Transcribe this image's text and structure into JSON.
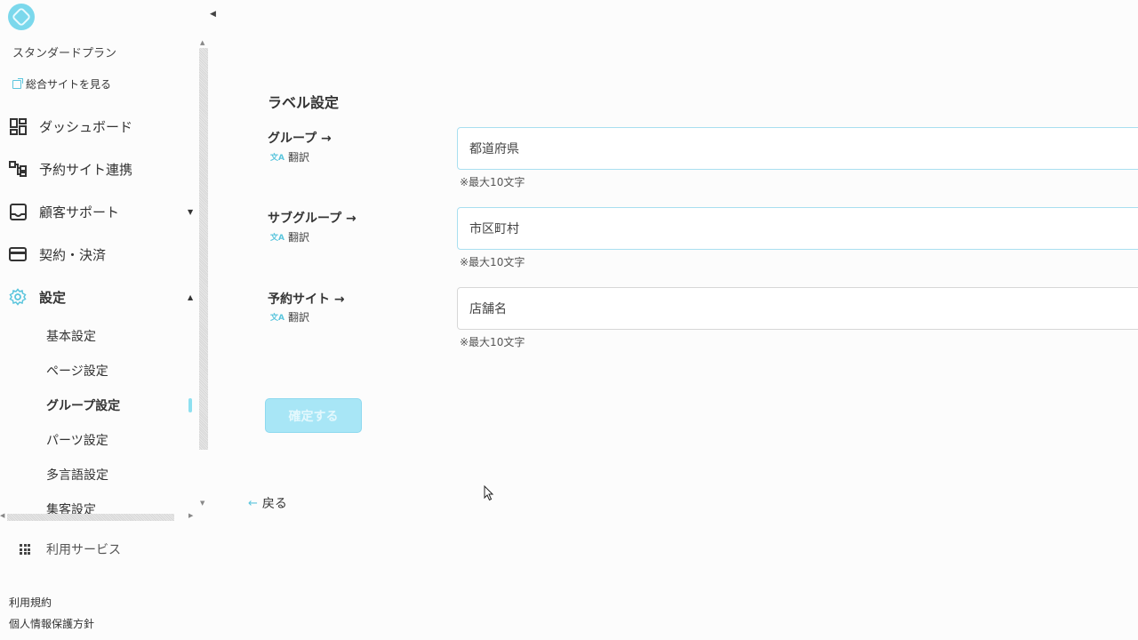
{
  "sidebar": {
    "plan": "スタンダードプラン",
    "portal_link": "総合サイトを見る",
    "nav": [
      {
        "label": "ダッシュボード"
      },
      {
        "label": "予約サイト連携"
      },
      {
        "label": "顧客サポート"
      },
      {
        "label": "契約・決済"
      },
      {
        "label": "設定"
      }
    ],
    "sub_nav": [
      {
        "label": "基本設定"
      },
      {
        "label": "ページ設定"
      },
      {
        "label": "グループ設定"
      },
      {
        "label": "パーツ設定"
      },
      {
        "label": "多言語設定"
      },
      {
        "label": "集客設定"
      }
    ],
    "services": "利用サービス",
    "footer": [
      "利用規約",
      "個人情報保護方針"
    ]
  },
  "main": {
    "section_title": "ラベル設定",
    "rows": [
      {
        "label": "グループ →",
        "translate": "翻訳",
        "value": "都道府県",
        "hint": "※最大10文字"
      },
      {
        "label": "サブグループ →",
        "translate": "翻訳",
        "value": "市区町村",
        "hint": "※最大10文字"
      },
      {
        "label": "予約サイト →",
        "translate": "翻訳",
        "value": "店舗名",
        "hint": "※最大10文字"
      }
    ],
    "confirm_label": "確定する",
    "back_label": "戻る"
  },
  "colors": {
    "accent": "#5bc5dd",
    "button_disabled": "#a8e6f6",
    "page_bg": "#fcfcfc"
  }
}
